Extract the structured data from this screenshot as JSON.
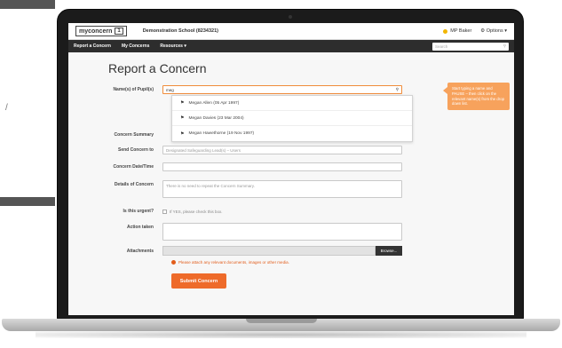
{
  "app": {
    "logo_text": "myconcern",
    "logo_badge": "1",
    "school_name": "Demonstration School (8234321)",
    "user_name": "MP Baker",
    "options_label": "Options ▾"
  },
  "nav": {
    "items": [
      "Report a Concern",
      "My Concerns",
      "Resources ▾"
    ],
    "search_placeholder": "Search"
  },
  "form": {
    "title": "Report a Concern",
    "pupil_label": "Name(s) of Pupil(s)",
    "pupil_value": "meg",
    "summary_label": "Concern Summary",
    "send_label": "Send Concern to",
    "send_value": "Designated Safeguarding Lead(s) – Users",
    "datetime_label": "Concern Date/Time",
    "details_label": "Details of Concern",
    "details_placeholder": "There is no need to repeat the Concern Summary.",
    "urgent_label": "Is this urgent?",
    "urgent_hint": "If YES, please check this box.",
    "action_label": "Action taken",
    "attachments_label": "Attachments",
    "browse_label": "Browse...",
    "attach_hint": "Please attach any relevant documents, images or other media.",
    "submit_label": "Submit Concern"
  },
  "suggestions": [
    "Megan Allen (05 Apr 1997)",
    "Megan Davies (23 Mar 2004)",
    "Megan Hawethorne (19 Nov 1997)"
  ],
  "tooltip": "Start typing a name and PAUSE – then click on the relevant name(s) from the drop down list.",
  "decor": {
    "slash": "/"
  },
  "colors": {
    "accent": "#ee6b2a",
    "tooltip": "#f7a25c",
    "navbar": "#2d2d2d"
  }
}
